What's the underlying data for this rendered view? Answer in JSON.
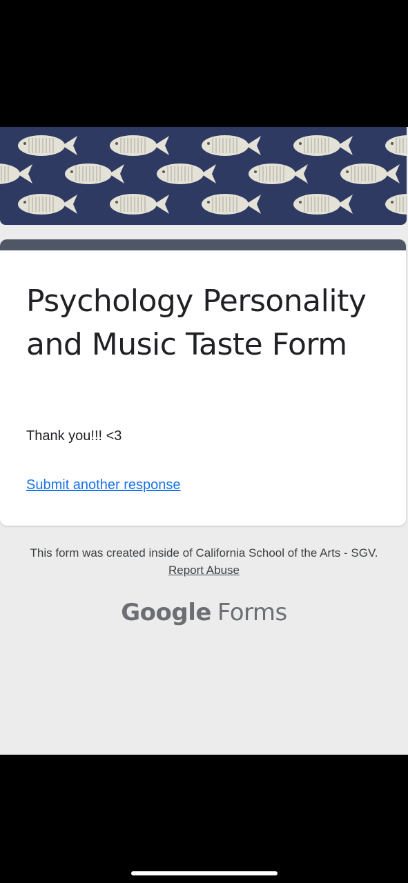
{
  "form": {
    "title": "Psychology Personality and Music Taste Form",
    "confirmation_message": "Thank you!!! <3",
    "submit_another_label": "Submit another response"
  },
  "footer": {
    "created_text": "This form was created inside of California School of the Arts - SGV.",
    "report_abuse_label": "Report Abuse"
  },
  "branding": {
    "google": "Google",
    "forms": "Forms"
  },
  "colors": {
    "banner_bg": "#2e3a62",
    "card_accent": "#4f5666",
    "link": "#1a73e8",
    "page_bg": "#ececec"
  },
  "icons": {
    "banner_pattern": "fish-pattern"
  }
}
